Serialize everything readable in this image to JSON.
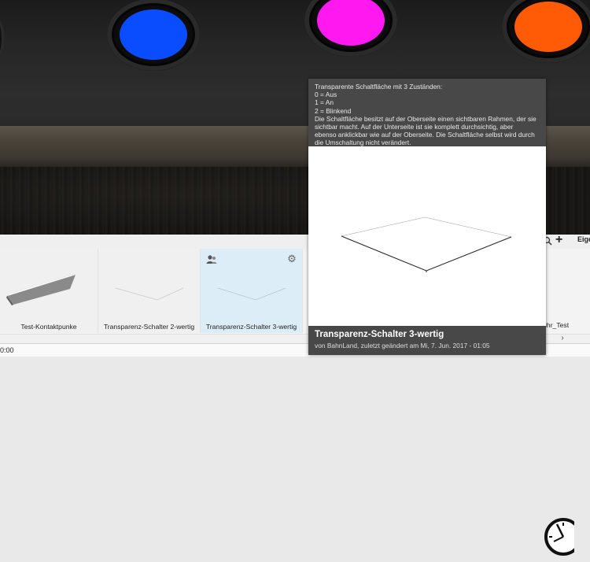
{
  "scene": {
    "lamps": [
      {
        "name": "blue",
        "color": "#0a4dff"
      },
      {
        "name": "magenta",
        "color": "#ff18f0"
      },
      {
        "name": "orange",
        "color": "#ff5a06"
      }
    ]
  },
  "tooltip": {
    "description_lines": [
      "Transparente Schaltfläche mit 3 Zuständen:",
      "0 = Aus",
      "1 = An",
      "2 = Blinkend",
      "Die Schaltfläche besitzt auf der Oberseite einen sichtbaren Rahmen, der sie",
      "sichtbar macht. Auf der Unterseite ist sie komplett durchsichtig, aber",
      "ebenso anklickbar wie auf der Oberseite. Die Schaltfläche selbst wird durch",
      "die Umschaltung nicht verändert."
    ],
    "title": "Transparenz-Schalter 3-wertig",
    "subtitle": "von BahnLand, zuletzt geändert am Mi, 7. Jun. 2017 - 01:05"
  },
  "toolbar": {
    "plus_label": "+",
    "properties_label": "Eige"
  },
  "library": {
    "items": [
      {
        "label": "Test-Kontaktpunke"
      },
      {
        "label": "Transparenz-Schalter 2-wertig"
      },
      {
        "label": "Transparenz-Schalter 3-wertig"
      }
    ],
    "partial_label": "ihr_Test"
  },
  "scrollbar": {
    "arrow": "›"
  },
  "status": {
    "time": "0:00"
  }
}
